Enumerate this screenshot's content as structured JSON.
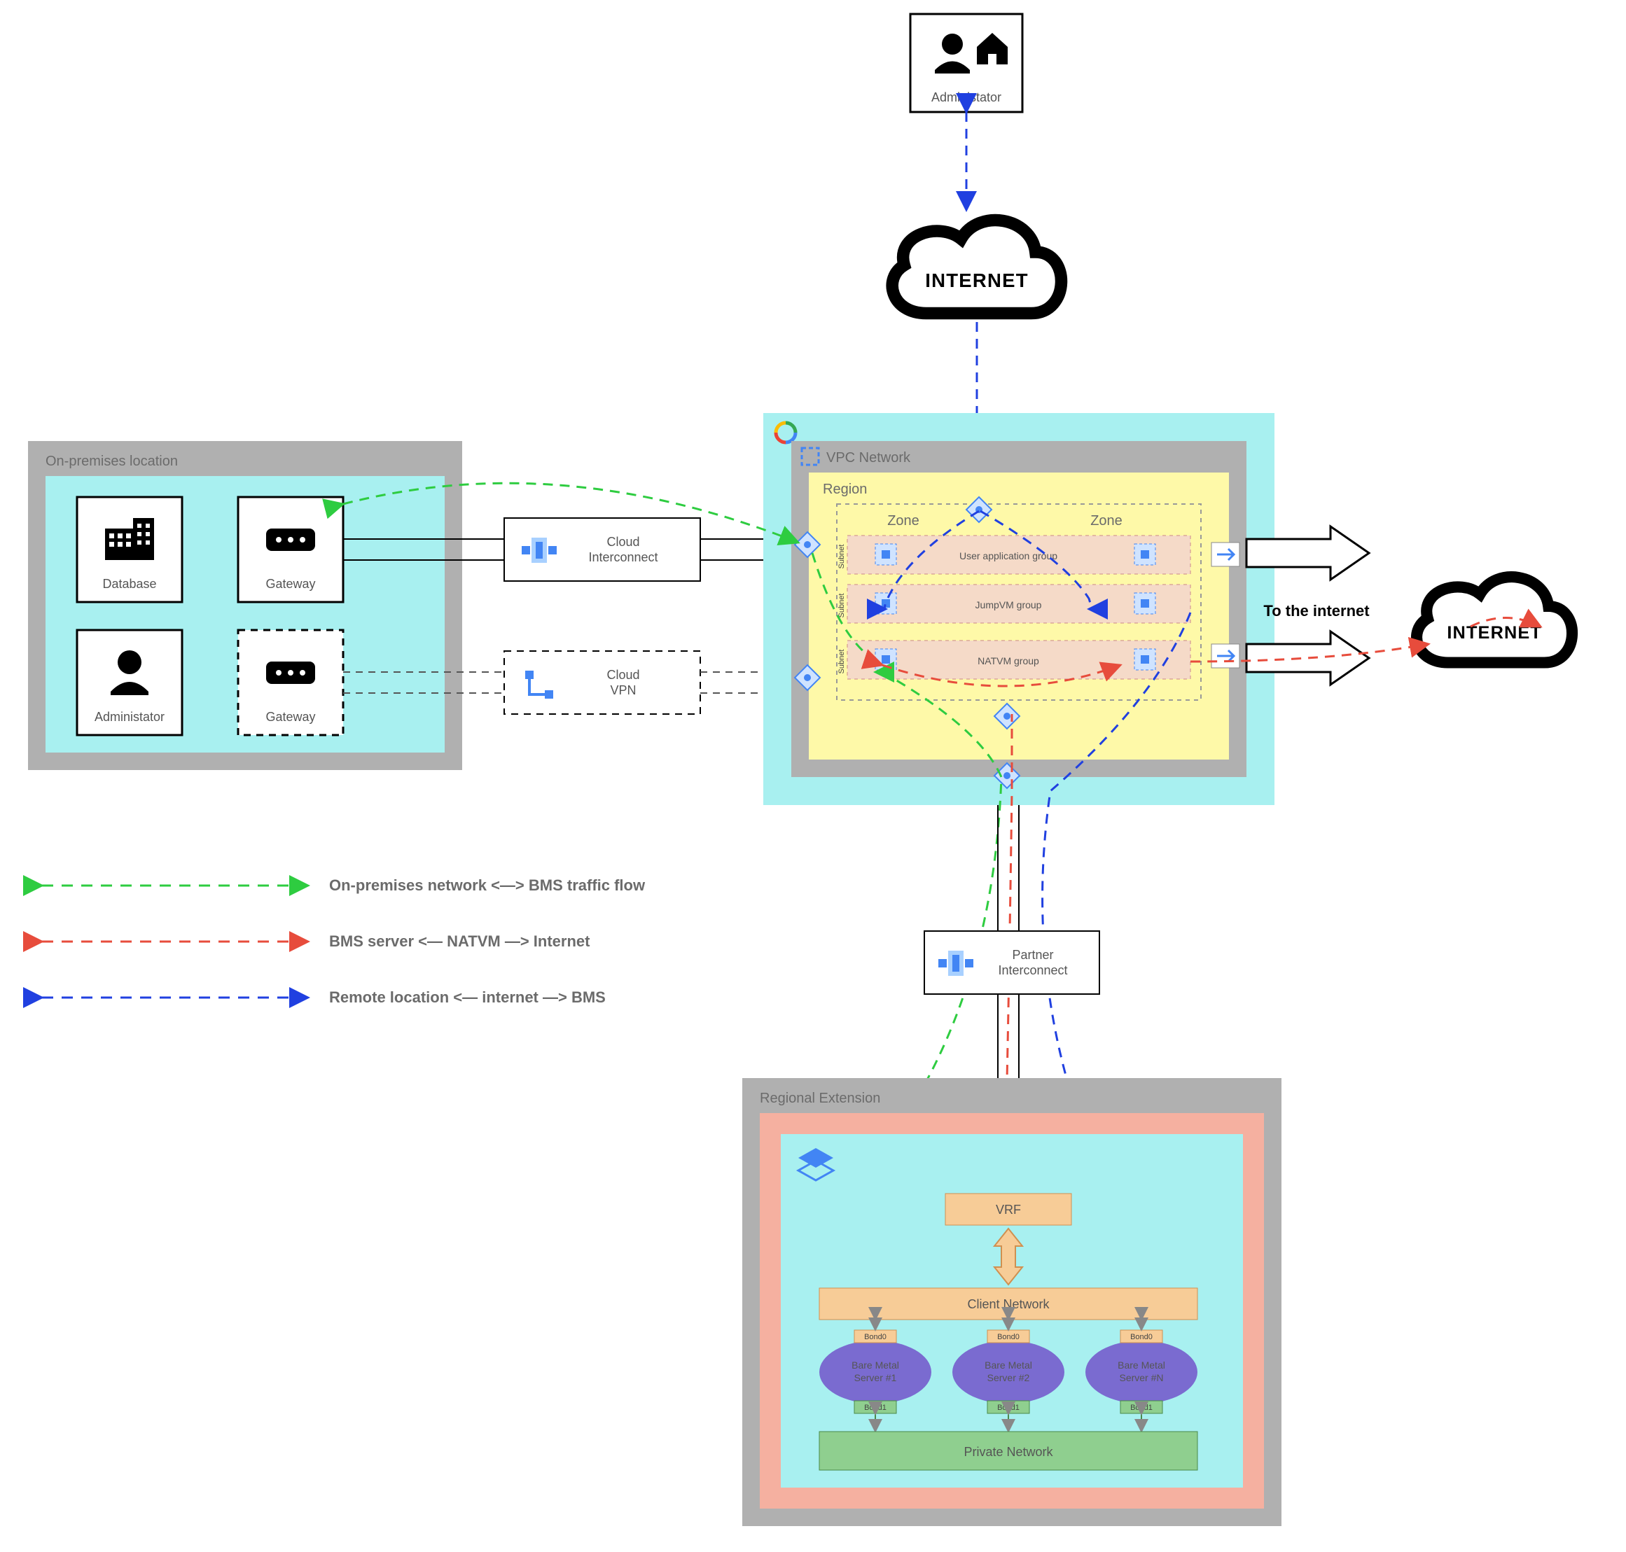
{
  "admin_top": "Administator",
  "internet": "INTERNET",
  "onprem": {
    "title": "On-premises location",
    "database": "Database",
    "gateway": "Gateway",
    "admin": "Administator"
  },
  "cloud_interconnect": "Cloud\nInterconnect",
  "cloud_vpn": "Cloud\nVPN",
  "vpc": {
    "title": "VPC Network",
    "region": "Region",
    "zone": "Zone",
    "subnet": "Subnet",
    "user_app": "User application group",
    "jump": "JumpVM group",
    "nat": "NATVM group"
  },
  "to_internet": "To the internet",
  "partner_interconnect": "Partner\nInterconnect",
  "ext": {
    "title": "Regional Extension",
    "vrf": "VRF",
    "client_net": "Client Network",
    "bms1": "Bare Metal\nServer #1",
    "bms2": "Bare Metal\nServer #2",
    "bmsN": "Bare Metal\nServer #N",
    "bond0": "Bond0",
    "bond1": "Bond1",
    "priv_net": "Private Network"
  },
  "legend": {
    "l1": "On-premises network <—> BMS traffic flow",
    "l2": "BMS server   <— NATVM —>   Internet",
    "l3": "Remote location   <— internet —>   BMS"
  },
  "colors": {
    "grey_frame": "#b0b0b0",
    "cyan": "#a8f0f0",
    "yellow": "#fef9a8",
    "salmon": "#f5c6b0",
    "salmon_border": "#d08060",
    "green_net": "#8fcf8f",
    "orange": "#f7cc97",
    "orange_border": "#d09050",
    "blue_icon": "#4285f4",
    "purple": "#7a6bd0",
    "green_line": "#2ecc40",
    "red_line": "#e74c3c",
    "blue_line": "#2040e0"
  }
}
